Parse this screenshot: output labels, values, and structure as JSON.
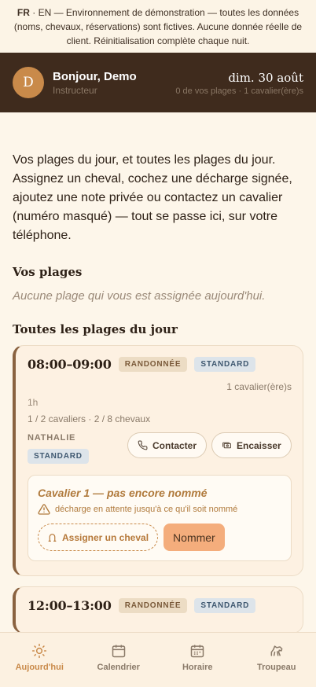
{
  "banner": {
    "lang_active": "FR",
    "lang_sep": " · ",
    "lang_other": "EN",
    "text": " — Environnement de démonstration — toutes les données (noms, chevaux, réservations) sont fictives. Aucune donnée réelle de client. Réinitialisation complète chaque nuit."
  },
  "header": {
    "avatar_initial": "D",
    "greeting": "Bonjour, Demo",
    "role": "Instructeur",
    "date": "dim. 30 août",
    "counts": "0 de vos plages · 1 cavalier(ère)s"
  },
  "intro": "Vos plages du jour, et toutes les plages du jour. Assignez un cheval, cochez une décharge signée, ajoutez une note privée ou contactez un cavalier (numéro masqué) — tout se passe ici, sur votre téléphone.",
  "my_slots": {
    "title": "Vos plages",
    "empty": "Aucune plage qui vous est assignée aujourd'hui."
  },
  "all_slots": {
    "title": "Toutes les plages du jour",
    "slots": [
      {
        "time": "08:00–09:00",
        "type_tag": "RANDONNÉE",
        "level_tag": "STANDARD",
        "riders_count": "1 cavalier(ère)s",
        "duration": "1h",
        "capacity": "1 / 2 cavaliers · 2 / 8 chevaux",
        "instructor": "NATHALIE",
        "instructor_tag": "STANDARD",
        "contact_label": "Contacter",
        "cash_label": "Encaisser",
        "rider": {
          "title": "Cavalier 1 — pas encore nommé",
          "warning": "décharge en attente jusqu'à ce qu'il soit nommé",
          "assign_label": "Assigner un cheval",
          "name_label": "Nommer"
        }
      },
      {
        "time": "12:00–13:00",
        "type_tag": "RANDONNÉE",
        "level_tag": "STANDARD"
      }
    ]
  },
  "tabs": [
    {
      "label": "Aujourd'hui",
      "icon": "sun-icon",
      "active": true
    },
    {
      "label": "Calendrier",
      "icon": "calendar-icon",
      "active": false
    },
    {
      "label": "Horaire",
      "icon": "schedule-icon",
      "active": false
    },
    {
      "label": "Troupeau",
      "icon": "horse-icon",
      "active": false
    }
  ],
  "colors": {
    "accent": "#c98a4a",
    "header_bg": "#3f2b1d",
    "page_bg": "#fdf6ea",
    "primary_button": "#f4ad7c"
  }
}
